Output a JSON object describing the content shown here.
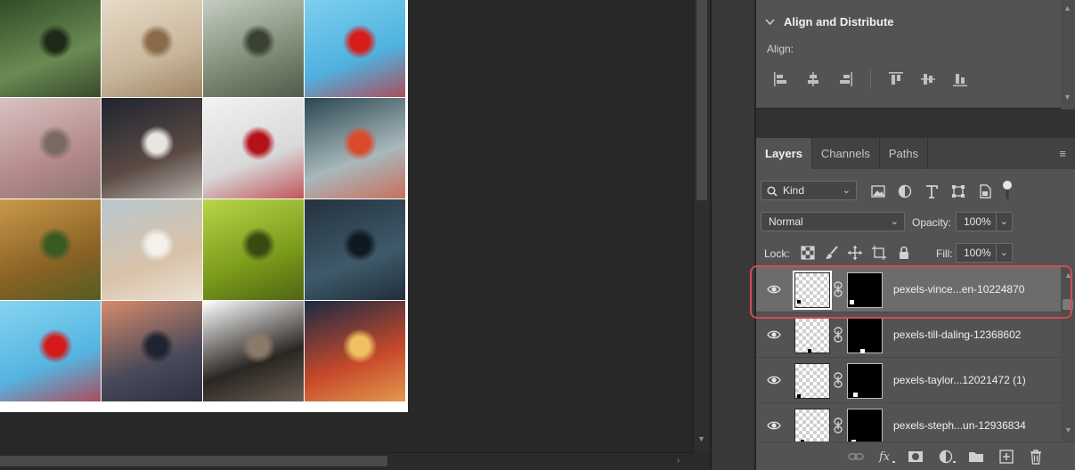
{
  "canvas": {
    "tiles": [
      {
        "name": "lake-forest",
        "colors": [
          "#2f4a27",
          "#6a8a52",
          "#1d2a18"
        ]
      },
      {
        "name": "chairs-room",
        "colors": [
          "#e9dcc9",
          "#c9b79c",
          "#8a6a4a"
        ]
      },
      {
        "name": "garden-pavilion",
        "colors": [
          "#c8d0c4",
          "#7d8a74",
          "#3a4234"
        ]
      },
      {
        "name": "red-flower-water",
        "colors": [
          "#7fd0ef",
          "#4fb2e0",
          "#d81c1c"
        ]
      },
      {
        "name": "pink-chairs",
        "colors": [
          "#d9c2c2",
          "#b48a8a",
          "#7a6a62"
        ]
      },
      {
        "name": "portrait-woman",
        "colors": [
          "#1f2430",
          "#5a4a44",
          "#e8e4de"
        ]
      },
      {
        "name": "cherries-plate",
        "colors": [
          "#f2f2f2",
          "#d8d8d8",
          "#b3121a"
        ]
      },
      {
        "name": "ship-railing",
        "colors": [
          "#2b4650",
          "#a8b8bc",
          "#d94b2a"
        ]
      },
      {
        "name": "sand-dune",
        "colors": [
          "#c99a4a",
          "#8a6224",
          "#3a5a22"
        ]
      },
      {
        "name": "desert-woman",
        "colors": [
          "#b8c8cf",
          "#d8c2a8",
          "#f4f0ea"
        ]
      },
      {
        "name": "green-seats",
        "colors": [
          "#b8d64a",
          "#7a9a1a",
          "#3a4a12"
        ]
      },
      {
        "name": "rain-street",
        "colors": [
          "#24323e",
          "#3e5a6a",
          "#101820"
        ]
      },
      {
        "name": "red-flower-water-2",
        "colors": [
          "#86d4f0",
          "#55b4e2",
          "#d41a1a"
        ]
      },
      {
        "name": "city-tower",
        "colors": [
          "#d88a6a",
          "#4a4a5a",
          "#1f2430"
        ]
      },
      {
        "name": "man-portrait",
        "colors": [
          "#ffffff",
          "#2a2622",
          "#8a7a6a"
        ]
      },
      {
        "name": "night-street",
        "colors": [
          "#1a2a44",
          "#c84a2a",
          "#f0c060"
        ]
      }
    ]
  },
  "align_panel": {
    "title": "Align and Distribute",
    "align_label": "Align:"
  },
  "layers_panel": {
    "tabs": [
      {
        "label": "Layers",
        "active": true
      },
      {
        "label": "Channels",
        "active": false
      },
      {
        "label": "Paths",
        "active": false
      }
    ],
    "filter": {
      "value": "Kind"
    },
    "blend_mode": {
      "value": "Normal"
    },
    "opacity": {
      "label": "Opacity:",
      "value": "100%"
    },
    "lock": {
      "label": "Lock:"
    },
    "fill": {
      "label": "Fill:",
      "value": "100%"
    },
    "layers": [
      {
        "name": "pexels-vince...en-10224870",
        "selected": true
      },
      {
        "name": "pexels-till-daling-12368602",
        "selected": false
      },
      {
        "name": "pexels-taylor...12021472 (1)",
        "selected": false
      },
      {
        "name": "pexels-steph...un-12936834",
        "selected": false
      }
    ]
  },
  "colors": {
    "selection_outline": "#d34a54",
    "panel_bg": "#535353",
    "canvas_bg": "#282828"
  }
}
